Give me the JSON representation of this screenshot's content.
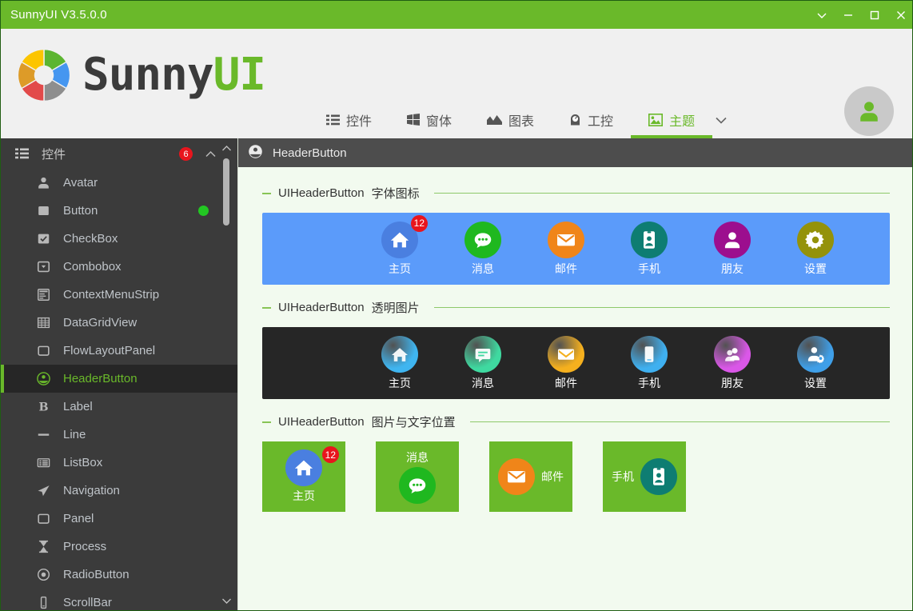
{
  "window": {
    "title": "SunnyUI V3.5.0.0",
    "controls": [
      {
        "name": "chevron-down",
        "glyph": "chevron-down-icon"
      },
      {
        "name": "minimize",
        "glyph": "minimize-icon"
      },
      {
        "name": "maximize",
        "glyph": "maximize-icon"
      },
      {
        "name": "close",
        "glyph": "close-icon"
      }
    ],
    "titlebar_color": "#6ab92a"
  },
  "header": {
    "logo_text_dark": "Sunny",
    "logo_text_green": "UI",
    "avatar_icon": "user-avatar-icon",
    "tabs": [
      {
        "label": "控件",
        "icon": "list-icon",
        "active": false
      },
      {
        "label": "窗体",
        "icon": "windows-icon",
        "active": false
      },
      {
        "label": "图表",
        "icon": "chart-icon",
        "active": false
      },
      {
        "label": "工控",
        "icon": "gauge-icon",
        "active": false
      },
      {
        "label": "主题",
        "icon": "image-icon",
        "active": true
      }
    ],
    "tab_caret": "chevron-down-icon",
    "accent_color": "#6ab92a"
  },
  "sidebar": {
    "group_title": "控件",
    "group_icon": "list-icon",
    "badge": "6",
    "collapse_icon": "chevron-up-icon",
    "scroll_up_icon": "chevron-up-icon",
    "scroll_down_icon": "chevron-down-icon",
    "items": [
      {
        "label": "Avatar",
        "icon": "person-icon",
        "selected": false,
        "dot": false
      },
      {
        "label": "Button",
        "icon": "square-filled-icon",
        "selected": false,
        "dot": true
      },
      {
        "label": "CheckBox",
        "icon": "checkbox-icon",
        "selected": false,
        "dot": false
      },
      {
        "label": "Combobox",
        "icon": "combobox-icon",
        "selected": false,
        "dot": false
      },
      {
        "label": "ContextMenuStrip",
        "icon": "menu-strip-icon",
        "selected": false,
        "dot": false
      },
      {
        "label": "DataGridView",
        "icon": "grid-icon",
        "selected": false,
        "dot": false
      },
      {
        "label": "FlowLayoutPanel",
        "icon": "square-outline-icon",
        "selected": false,
        "dot": false
      },
      {
        "label": "HeaderButton",
        "icon": "header-button-icon",
        "selected": true,
        "dot": false
      },
      {
        "label": "Label",
        "icon": "bold-b-icon",
        "selected": false,
        "dot": false
      },
      {
        "label": "Line",
        "icon": "line-icon",
        "selected": false,
        "dot": false
      },
      {
        "label": "ListBox",
        "icon": "listbox-icon",
        "selected": false,
        "dot": false
      },
      {
        "label": "Navigation",
        "icon": "paper-plane-icon",
        "selected": false,
        "dot": false
      },
      {
        "label": "Panel",
        "icon": "square-outline-icon",
        "selected": false,
        "dot": false
      },
      {
        "label": "Process",
        "icon": "hourglass-icon",
        "selected": false,
        "dot": false
      },
      {
        "label": "RadioButton",
        "icon": "radio-icon",
        "selected": false,
        "dot": false
      },
      {
        "label": "ScrollBar",
        "icon": "scrollbar-icon",
        "selected": false,
        "dot": false
      }
    ]
  },
  "content": {
    "head_title": "HeaderButton",
    "head_icon": "header-button-icon",
    "sections": [
      {
        "title_prefix": "UIHeaderButton",
        "title_suffix": "字体图标",
        "panel_color": "#5b9bfa",
        "buttons": [
          {
            "label": "主页",
            "icon": "home-icon",
            "circle": "#4a7fe0",
            "badge": "12"
          },
          {
            "label": "消息",
            "icon": "chat-icon",
            "circle": "#1fb81f",
            "badge": ""
          },
          {
            "label": "邮件",
            "icon": "envelope-icon",
            "circle": "#f08519",
            "badge": ""
          },
          {
            "label": "手机",
            "icon": "id-card-icon",
            "circle": "#0e7d72",
            "badge": ""
          },
          {
            "label": "朋友",
            "icon": "person-icon",
            "circle": "#9c0e8e",
            "badge": ""
          },
          {
            "label": "设置",
            "icon": "gear-icon",
            "circle": "#94920a",
            "badge": ""
          }
        ]
      },
      {
        "title_prefix": "UIHeaderButton",
        "title_suffix": "透明图片",
        "panel_color": "#262626",
        "buttons": [
          {
            "label": "主页",
            "icon": "home-image-icon",
            "circle": "#3fb5f0",
            "badge": ""
          },
          {
            "label": "消息",
            "icon": "chat-image-icon",
            "circle": "#3fd9a0",
            "badge": ""
          },
          {
            "label": "邮件",
            "icon": "envelope-image-icon",
            "circle": "#f5b01e",
            "badge": ""
          },
          {
            "label": "手机",
            "icon": "phone-image-icon",
            "circle": "#3fb0f0",
            "badge": ""
          },
          {
            "label": "朋友",
            "icon": "friends-image-icon",
            "circle": "#da57e8",
            "badge": ""
          },
          {
            "label": "设置",
            "icon": "user-settings-image-icon",
            "circle": "#3f9fe8",
            "badge": ""
          }
        ]
      },
      {
        "title_prefix": "UIHeaderButton",
        "title_suffix": "图片与文字位置",
        "tile_color": "#6ab92a",
        "tiles": [
          {
            "label": "主页",
            "icon": "home-icon",
            "circle": "#4a7fe0",
            "badge": "12",
            "layout": "icon-top"
          },
          {
            "label": "消息",
            "icon": "chat-icon",
            "circle": "#1fb81f",
            "badge": "",
            "layout": "text-top"
          },
          {
            "label": "邮件",
            "icon": "envelope-icon",
            "circle": "#f08519",
            "badge": "",
            "layout": "icon-left"
          },
          {
            "label": "手机",
            "icon": "id-card-icon",
            "circle": "#0e7d72",
            "badge": "",
            "layout": "text-left"
          }
        ]
      }
    ]
  }
}
